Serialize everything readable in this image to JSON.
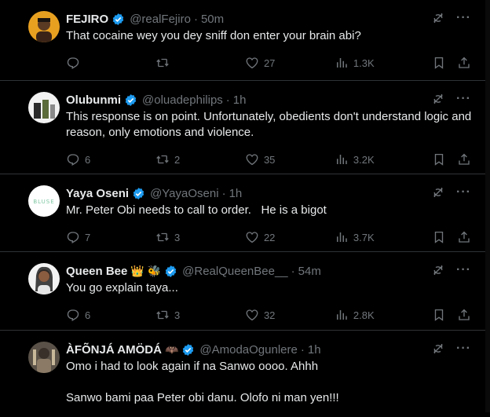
{
  "tweets": [
    {
      "name": "FEJIRO",
      "handle": "@realFejiro",
      "time": "50m",
      "text": "That cocaine wey you dey sniff don enter your brain abi?",
      "replies": "",
      "retweets": "",
      "likes": "27",
      "views": "1.3K"
    },
    {
      "name": "Olubunmi",
      "handle": "@oluadephilips",
      "time": "1h",
      "text": "This response is on point. Unfortunately, obedients don't understand logic and reason, only emotions and violence.",
      "replies": "6",
      "retweets": "2",
      "likes": "35",
      "views": "3.2K"
    },
    {
      "name": "Yaya Oseni",
      "handle": "@YayaOseni",
      "time": "1h",
      "text": "Mr. Peter Obi needs to call to order.   He is a bigot",
      "replies": "7",
      "retweets": "3",
      "likes": "22",
      "views": "3.7K",
      "avatar_text": "BLUSE"
    },
    {
      "name": "Queen Bee",
      "handle": "@RealQueenBee__",
      "time": "54m",
      "emoji": "👑 🐝",
      "text": "You go explain taya...",
      "replies": "6",
      "retweets": "3",
      "likes": "32",
      "views": "2.8K"
    },
    {
      "name": "ÀFÕNJÁ AMÖDÁ",
      "handle": "@AmodaOgunlere",
      "time": "1h",
      "emoji": "🦇",
      "text": "Omo i had to look again if na Sanwo oooo. Ahhh",
      "text2": "Sanwo bami paa Peter obi danu. Olofo ni man yen!!!"
    }
  ],
  "colors": {
    "background": "#000000",
    "text": "#e7e9ea",
    "muted": "#71767b",
    "border": "#2f3336",
    "verified": "#1d9bf0"
  },
  "icons": [
    "reply-icon",
    "retweet-icon",
    "like-icon",
    "views-icon",
    "bookmark-icon",
    "share-icon",
    "grok-icon",
    "more-icon",
    "verified-badge-icon"
  ]
}
